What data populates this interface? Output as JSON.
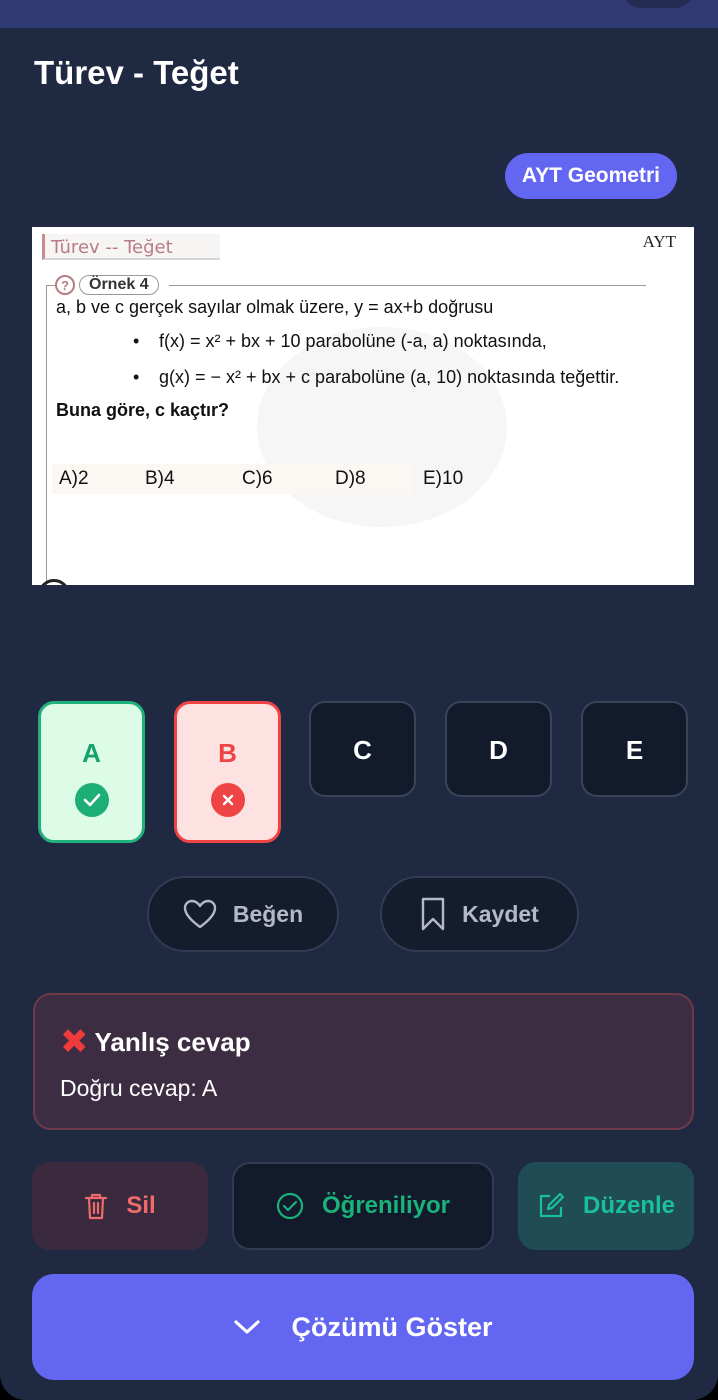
{
  "header": {
    "title": "Türev - Teğet",
    "badge": "AYT Geometri"
  },
  "question_image": {
    "heading": "Türev -- Teğet",
    "corner": "AYT",
    "example_icon": "?",
    "example_label": "Örnek 4",
    "line1": "a, b ve c gerçek sayılar olmak üzere, y = ax+b doğrusu",
    "line2": "f(x) = x² + bx + 10  parabolüne (-a, a) noktasında,",
    "line3": "g(x) = − x² + bx + c  parabolüne (a, 10) noktasında teğettir.",
    "question": "Buna göre, c kaçtır?",
    "options": [
      "A)2",
      "B)4",
      "C)6",
      "D)8",
      "E)10"
    ]
  },
  "choices": [
    {
      "letter": "A",
      "state": "correct",
      "icon": "check-circle-icon"
    },
    {
      "letter": "B",
      "state": "wrong",
      "icon": "x-circle-icon"
    },
    {
      "letter": "C",
      "state": "none"
    },
    {
      "letter": "D",
      "state": "none"
    },
    {
      "letter": "E",
      "state": "none"
    }
  ],
  "actions_top": {
    "like_label": "Beğen",
    "like_icon": "heart-icon",
    "save_label": "Kaydet",
    "save_icon": "bookmark-icon"
  },
  "result": {
    "icon": "cross-mark-icon",
    "title": "Yanlış cevap",
    "correct_answer": "Doğru cevap: A"
  },
  "actions_bottom": {
    "delete_label": "Sil",
    "delete_icon": "trash-icon",
    "learning_label": "Öğreniliyor",
    "learning_icon": "check-circle-outline-icon",
    "edit_label": "Düzenle",
    "edit_icon": "edit-icon"
  },
  "show_solution": {
    "label": "Çözümü Göster",
    "icon": "chevron-down-icon"
  },
  "colors": {
    "accent": "#6366f1",
    "correct": "#22b07d",
    "wrong": "#ef4444",
    "background": "#1f2942"
  }
}
